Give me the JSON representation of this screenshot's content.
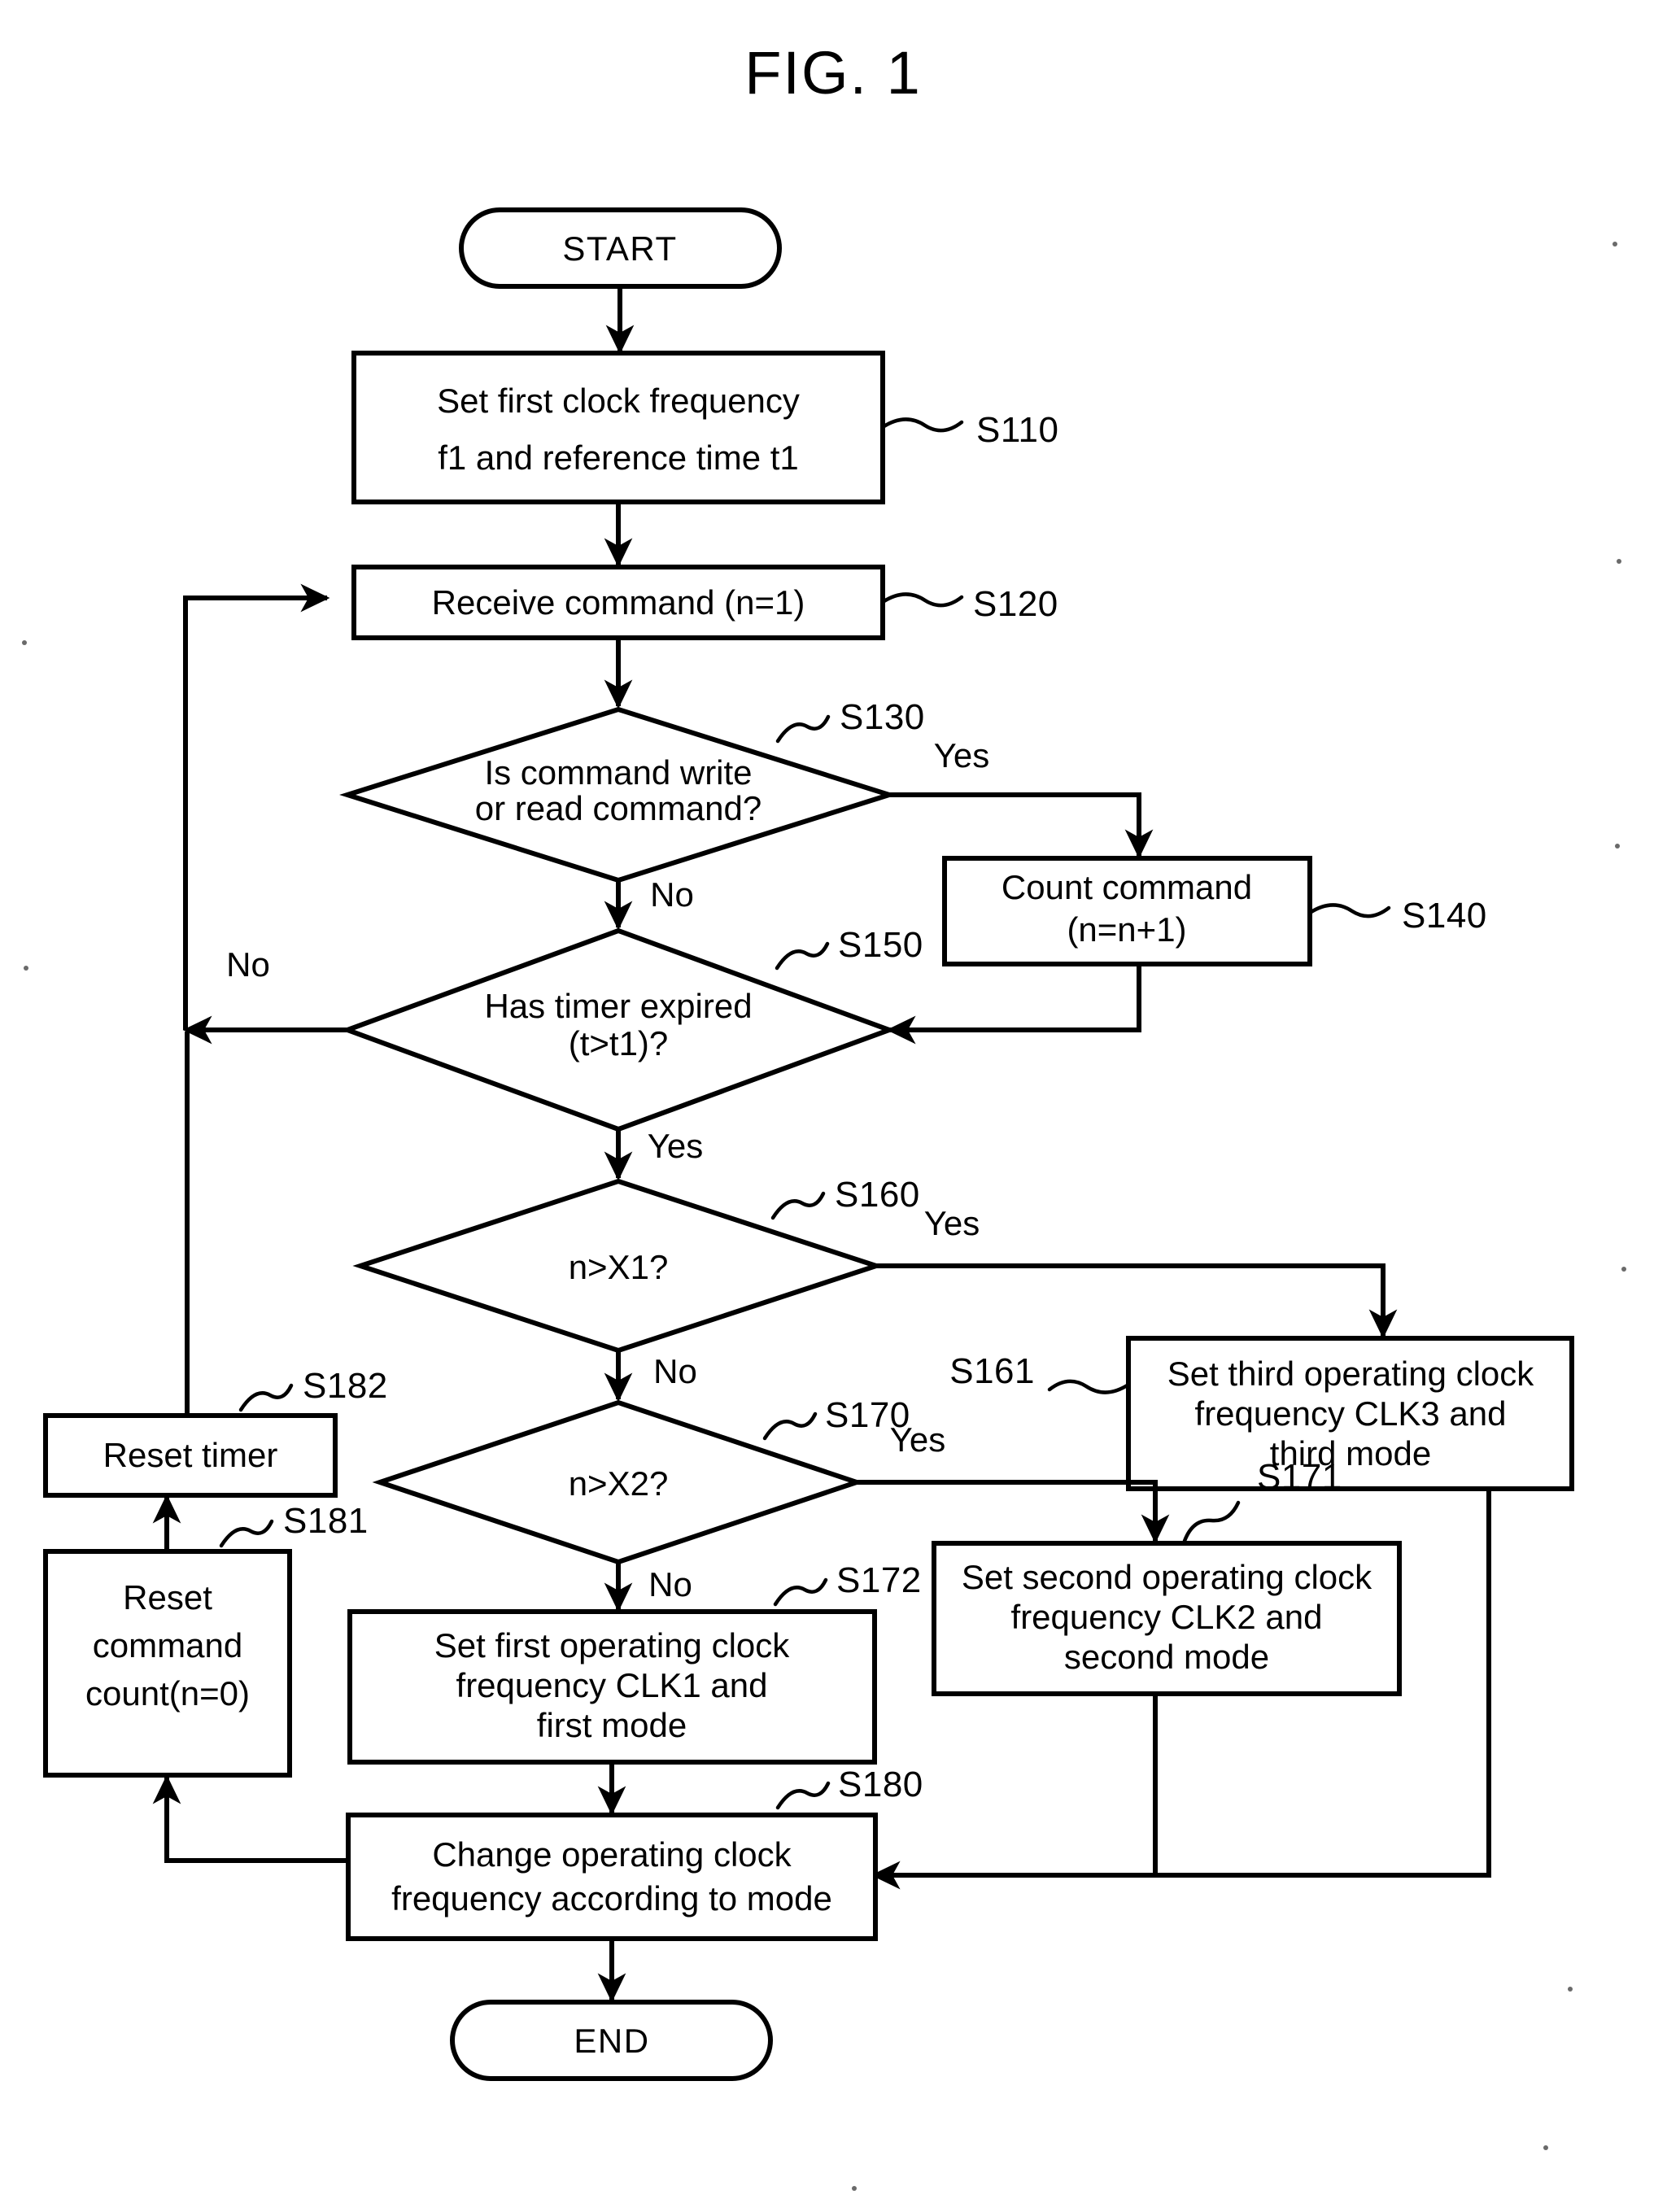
{
  "figure": {
    "title": "FIG. 1",
    "type": "flowchart"
  },
  "terminators": {
    "start": "START",
    "end": "END"
  },
  "nodes": {
    "s110": {
      "step": "S110",
      "shape": "process",
      "lines": [
        "Set first clock frequency",
        "f1 and reference time t1"
      ]
    },
    "s120": {
      "step": "S120",
      "shape": "process",
      "lines": [
        "Receive command (n=1)"
      ]
    },
    "s130": {
      "step": "S130",
      "shape": "decision",
      "lines": [
        "Is command write",
        "or read command?"
      ]
    },
    "s140": {
      "step": "S140",
      "shape": "process",
      "lines": [
        "Count command",
        "(n=n+1)"
      ]
    },
    "s150": {
      "step": "S150",
      "shape": "decision",
      "lines": [
        "Has timer expired",
        "(t>t1)?"
      ]
    },
    "s160": {
      "step": "S160",
      "shape": "decision",
      "lines": [
        "n>X1?"
      ]
    },
    "s161": {
      "step": "S161",
      "shape": "process",
      "lines": [
        "Set third operating clock",
        "frequency CLK3 and",
        "third mode"
      ]
    },
    "s170": {
      "step": "S170",
      "shape": "decision",
      "lines": [
        "n>X2?"
      ]
    },
    "s171": {
      "step": "S171",
      "shape": "process",
      "lines": [
        "Set second operating clock",
        "frequency CLK2 and",
        "second mode"
      ]
    },
    "s172": {
      "step": "S172",
      "shape": "process",
      "lines": [
        "Set first operating clock",
        "frequency CLK1 and",
        "first mode"
      ]
    },
    "s180": {
      "step": "S180",
      "shape": "process",
      "lines": [
        "Change operating clock",
        "frequency according to mode"
      ]
    },
    "s181": {
      "step": "S181",
      "shape": "process",
      "lines": [
        "Reset",
        "command",
        "count(n=0)"
      ]
    },
    "s182": {
      "step": "S182",
      "shape": "process",
      "lines": [
        "Reset timer"
      ]
    }
  },
  "branch_labels": {
    "s130_yes": "Yes",
    "s130_no": "No",
    "s150_no": "No",
    "s150_yes": "Yes",
    "s160_yes": "Yes",
    "s160_no": "No",
    "s170_yes": "Yes",
    "s170_no": "No"
  },
  "colors": {
    "ink": "#000000",
    "paper": "#ffffff"
  }
}
